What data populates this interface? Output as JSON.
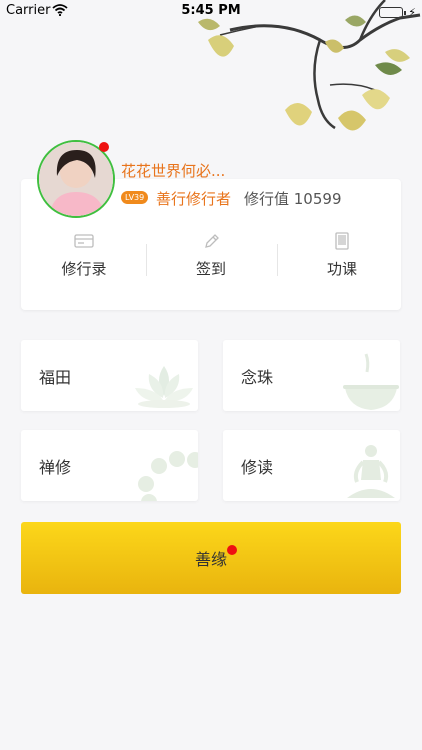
{
  "status_bar": {
    "carrier": "Carrier",
    "time": "5:45 PM",
    "battery_level": 1.0
  },
  "profile": {
    "nickname": "花花世界何必...",
    "level": "LV39",
    "title": "善行修行者",
    "cultivation_value": "修行值 10599",
    "has_notification": true
  },
  "actions": [
    {
      "label": "修行录",
      "icon": "card-icon"
    },
    {
      "label": "签到",
      "icon": "pencil-icon"
    },
    {
      "label": "功课",
      "icon": "book-icon"
    }
  ],
  "tiles": {
    "futian": "福田",
    "nianzhu": "念珠",
    "chanxiu": "禅修",
    "xiudu": "修读"
  },
  "donate_button": {
    "label": "善缘",
    "has_notification": true
  },
  "colors": {
    "accent_orange": "#e8741c",
    "avatar_ring": "#3fbf3f",
    "notification_red": "#ee1111",
    "button_yellow_top": "#fcd71a",
    "button_yellow_bottom": "#e9b40e"
  }
}
